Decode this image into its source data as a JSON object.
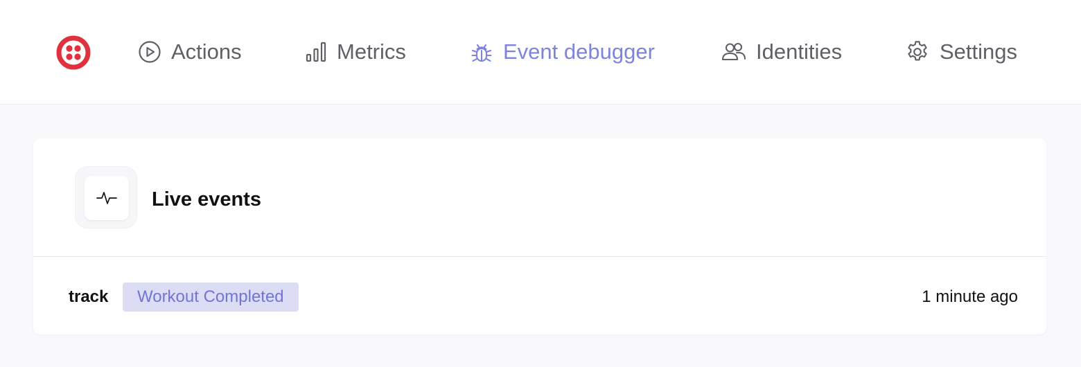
{
  "brand": {
    "logo_icon": "twilio-logo-icon",
    "color": "#e0313f"
  },
  "nav": {
    "accent_color": "#7e83de",
    "items": [
      {
        "label": "Actions",
        "icon": "play-circle-icon"
      },
      {
        "label": "Metrics",
        "icon": "bar-chart-icon"
      },
      {
        "label": "Event debugger",
        "icon": "bug-icon",
        "active": true
      },
      {
        "label": "Identities",
        "icon": "users-icon"
      },
      {
        "label": "Settings",
        "icon": "gear-icon"
      }
    ]
  },
  "live_events": {
    "title": "Live events",
    "icon": "activity-pulse-icon",
    "events": [
      {
        "type": "track",
        "name": "Workout Completed",
        "time": "1 minute ago"
      }
    ]
  }
}
